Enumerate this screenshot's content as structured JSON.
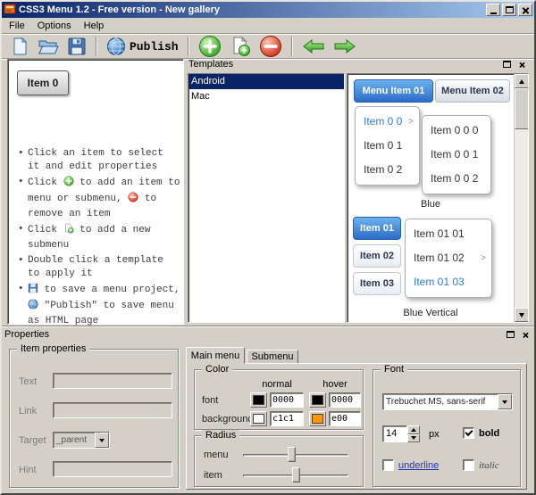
{
  "colors": {
    "face": "#d4d0c8",
    "selection": "#0a246a",
    "title-start": "#0a246a",
    "title-end": "#a6caf0",
    "blue-top": "#6cb2f0",
    "blue-bottom": "#2a6cc8",
    "link-blue": "#2a7de0"
  },
  "window": {
    "title": "CSS3 Menu 1.2 - Free version - New gallery"
  },
  "menubar": {
    "file": "File",
    "options": "Options",
    "help": "Help"
  },
  "toolbar": {
    "publish": "Publish"
  },
  "preview": {
    "item0": "Item 0",
    "instructions": {
      "line1": "Click an item to select it and edit properties",
      "line2a": "Click",
      "line2b": "to add an item to menu or submenu,",
      "line2c": "to remove an item",
      "line3a": "Click",
      "line3b": "to add a new submenu",
      "line4": "Double click a template to apply it",
      "line5a": "to save a menu project,",
      "line5b": "\"Publish\" to save menu as HTML page"
    }
  },
  "templates": {
    "title": "Templates",
    "items": [
      "Android",
      "Mac"
    ]
  },
  "gallery": {
    "arrow": ">",
    "horizontal": {
      "item1": "Menu Item 01",
      "item2": "Menu Item 02",
      "sub": [
        "Item 0 0",
        "Item 0 1",
        "Item 0 2"
      ],
      "subsub": [
        "Item 0 0 0",
        "Item 0 0 1",
        "Item 0 0 2"
      ],
      "caption": "Blue"
    },
    "vertical": {
      "items": [
        "Item 01",
        "Item 02",
        "Item 03"
      ],
      "sub": [
        "Item 01 01",
        "Item 01 02",
        "Item 01 03"
      ],
      "caption": "Blue Vertical"
    }
  },
  "properties": {
    "title": "Properties",
    "item_properties": {
      "title": "Item properties",
      "text_label": "Text",
      "link_label": "Link",
      "target_label": "Target",
      "target_value": "_parent",
      "hint_label": "Hint"
    },
    "tabs": {
      "main": "Main menu",
      "submenu": "Submenu"
    },
    "color": {
      "title": "Color",
      "normal_header": "normal",
      "hover_header": "hover",
      "font_label": "font",
      "background_label": "background",
      "font_normal": "0000",
      "font_hover": "0000",
      "background_normal": "c1c1",
      "background_hover": "e00",
      "font_normal_swatch": "#000000",
      "font_hover_swatch": "#000000",
      "background_normal_swatch": "#ffffff",
      "background_hover_swatch": "#ff9900"
    },
    "radius": {
      "title": "Radius",
      "menu_label": "menu",
      "item_label": "item"
    },
    "font": {
      "title": "Font",
      "family": "Trebuchet MS, sans-serif",
      "size": "14",
      "unit": "px",
      "bold_label": "bold",
      "underline_label": "underline",
      "italic_label": "italic"
    }
  }
}
